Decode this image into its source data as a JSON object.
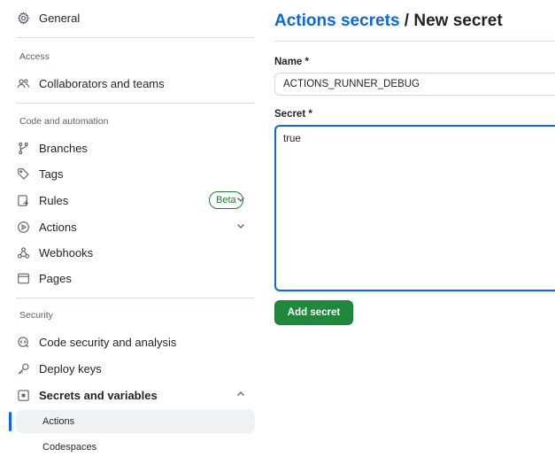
{
  "sidebar": {
    "general": "General",
    "access_label": "Access",
    "collaborators": "Collaborators and teams",
    "code_label": "Code and automation",
    "branches": "Branches",
    "tags": "Tags",
    "rules": "Rules",
    "rules_badge": "Beta",
    "actions": "Actions",
    "webhooks": "Webhooks",
    "pages": "Pages",
    "security_label": "Security",
    "code_security": "Code security and analysis",
    "deploy_keys": "Deploy keys",
    "secrets_variables": "Secrets and variables",
    "sub_actions": "Actions",
    "sub_codespaces": "Codespaces"
  },
  "main": {
    "breadcrumb_link": "Actions secrets",
    "breadcrumb_sep": " / ",
    "breadcrumb_current": "New secret",
    "name_label": "Name *",
    "name_value": "ACTIONS_RUNNER_DEBUG",
    "secret_label": "Secret *",
    "secret_value": "true",
    "submit_label": "Add secret"
  },
  "colors": {
    "link": "#0969da",
    "primary_button": "#1f883d",
    "beta_badge": "#1a7f37",
    "active_indicator": "#0969da"
  }
}
